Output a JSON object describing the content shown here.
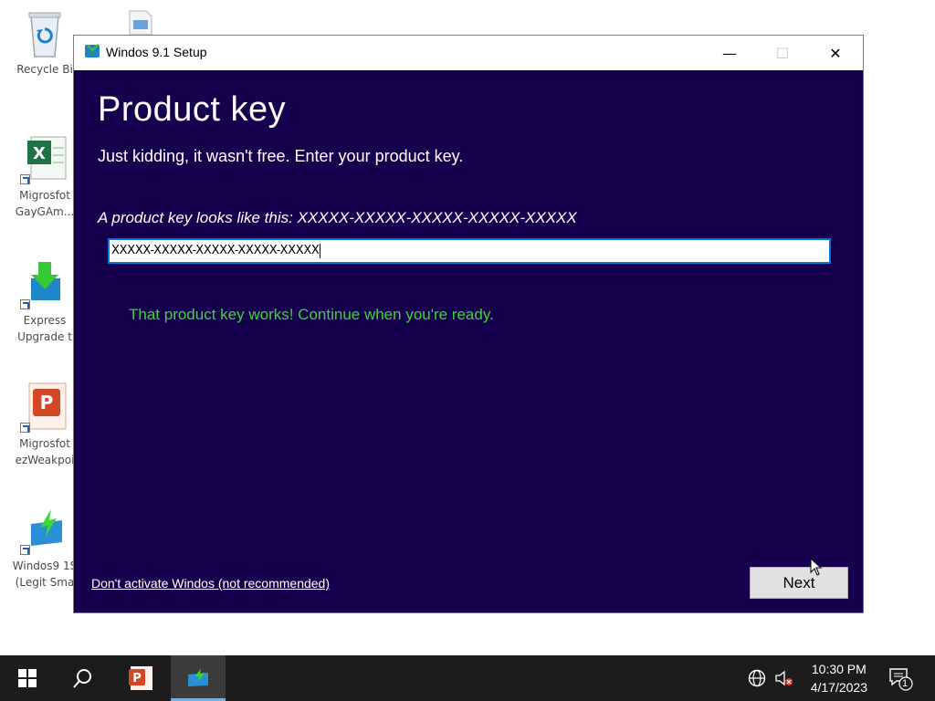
{
  "desktop": {
    "icons": [
      {
        "label": "Recycle Bi",
        "icon": "recycle-bin-icon"
      },
      {
        "label_line1": "Migrosfot",
        "label_line2": "GayGAm...",
        "icon": "excel-icon"
      },
      {
        "label_line1": "Express",
        "label_line2": "Upgrade t",
        "icon": "download-arrow-icon"
      },
      {
        "label_line1": "Migrosfot",
        "label_line2": "ezWeakpoi",
        "icon": "powerpoint-icon"
      },
      {
        "label_line1": "Windos9 1S",
        "label_line2": "(Legit Sma",
        "icon": "setup-icon"
      }
    ]
  },
  "window": {
    "title": "Windos 9.1 Setup",
    "minimize": "—",
    "maximize": "☐",
    "close": "✕"
  },
  "page": {
    "title": "Product key",
    "subtitle": "Just kidding, it wasn't free. Enter your product key.",
    "hint": "A product key looks like this: XXXXX-XXXXX-XXXXX-XXXXX-XXXXX",
    "key_value": "XXXXX-XXXXX-XXXXX-XXXXX-XXXXX",
    "success_message": "That product key works! Continue when you're ready.",
    "skip_link": "Don't activate Windos (not recommended)",
    "next_label": "Next"
  },
  "taskbar": {
    "time": "10:30 PM",
    "date": "4/17/2023",
    "notification_count": "1"
  },
  "colors": {
    "content_bg": "#16004d",
    "success_text": "#3ad43a",
    "input_focus": "#0078d7",
    "taskbar_bg": "#1c1c1c"
  }
}
